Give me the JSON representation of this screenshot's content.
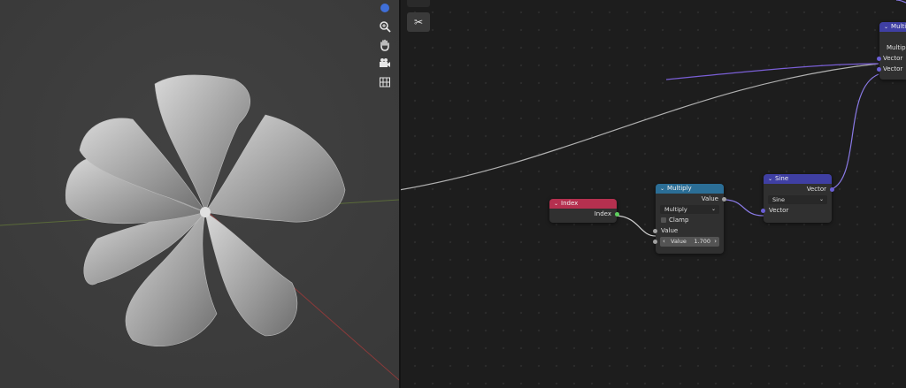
{
  "viewport": {
    "gizmos": [
      "zoom-icon",
      "hand-pan-icon",
      "camera-icon",
      "grid-perspective-icon"
    ]
  },
  "node_editor": {
    "nodes": {
      "index": {
        "title": "Index",
        "output": "Index",
        "header_color": "#b5304f"
      },
      "multiply_math": {
        "title": "Multiply",
        "header_color": "#2b6e96",
        "output": "Value",
        "operation": "Multiply",
        "clamp_label": "Clamp",
        "input1": "Value",
        "input2_label": "Value",
        "input2_value": "1.700"
      },
      "sine": {
        "title": "Sine",
        "header_color": "#3f3fa3",
        "output": "Vector",
        "operation": "Sine",
        "input": "Vector"
      },
      "multiply_vector": {
        "title": "Multiply",
        "header_color": "#3f3fa3",
        "operation": "Multiply",
        "input1": "Vector",
        "input2": "Vector"
      }
    }
  }
}
